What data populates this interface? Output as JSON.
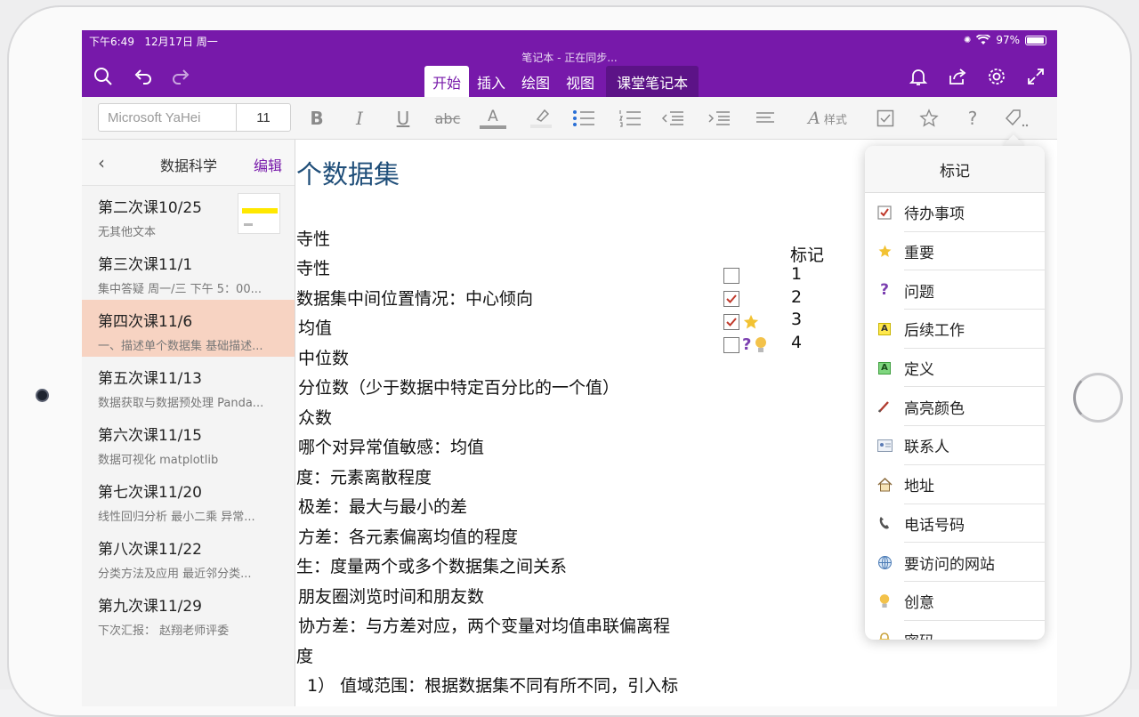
{
  "status": {
    "time": "下午6:49",
    "date": "12月17日 周一",
    "battery": "97%"
  },
  "window": {
    "sync_title": "笔记本 - 正在同步..."
  },
  "tabs": [
    {
      "label": "开始"
    },
    {
      "label": "插入"
    },
    {
      "label": "绘图"
    },
    {
      "label": "视图"
    },
    {
      "label": "课堂笔记本"
    }
  ],
  "ribbon": {
    "font_name": "Microsoft YaHei",
    "font_size": "11",
    "styles_label": "样式"
  },
  "sidebar": {
    "title": "数据科学",
    "edit": "编辑",
    "pages": [
      {
        "title": "第二次课10/25",
        "sub": "无其他文本"
      },
      {
        "title": "第三次课11/1",
        "sub": "集中答疑  周一/三 下午 5：00..."
      },
      {
        "title": "第四次课11/6",
        "sub": "一、描述单个数据集  基础描述..."
      },
      {
        "title": "第五次课11/13",
        "sub": "数据获取与数据预处理  Panda..."
      },
      {
        "title": "第六次课11/15",
        "sub": "数据可视化  matplotlib"
      },
      {
        "title": "第七次课11/20",
        "sub": "线性回归分析  最小二乘  异常..."
      },
      {
        "title": "第八次课11/22",
        "sub": "分类方法及应用  最近邻分类..."
      },
      {
        "title": "第九次课11/29",
        "sub": "下次汇报：  赵翔老师评委"
      }
    ]
  },
  "content": {
    "heading": "个数据集",
    "lines": [
      "寺性",
      "寺性",
      "数据集中间位置情况：中心倾向",
      "均值",
      "中位数",
      "分位数（少于数据中特定百分比的一个值）",
      "众数",
      "哪个对异常值敏感：均值",
      "度：元素离散程度",
      "极差：最大与最小的差",
      "方差：各元素偏离均值的程度",
      "生：度量两个或多个数据集之间关系",
      "朋友圈浏览时间和朋友数",
      "协方差：与方差对应，两个变量对均值串联偏离程",
      "度",
      "1）  值域范围：根据数据集不同有所不同，引入标"
    ],
    "tags_title": "标记",
    "tag_numbers": [
      "1",
      "2",
      "3",
      "4"
    ]
  },
  "tags_panel": {
    "title": "标记",
    "items": [
      {
        "label": "待办事项",
        "icon": "checkbox-icon"
      },
      {
        "label": "重要",
        "icon": "star-icon"
      },
      {
        "label": "问题",
        "icon": "question-icon"
      },
      {
        "label": "后续工作",
        "icon": "follow-up-icon"
      },
      {
        "label": "定义",
        "icon": "definition-icon"
      },
      {
        "label": "高亮颜色",
        "icon": "pen-icon"
      },
      {
        "label": "联系人",
        "icon": "contact-card-icon"
      },
      {
        "label": "地址",
        "icon": "house-icon"
      },
      {
        "label": "电话号码",
        "icon": "phone-icon"
      },
      {
        "label": "要访问的网站",
        "icon": "globe-icon"
      },
      {
        "label": "创意",
        "icon": "lightbulb-icon"
      },
      {
        "label": "密码",
        "icon": "lock-icon"
      }
    ]
  },
  "colors": {
    "accent": "#7719aa",
    "selected_page": "#f7d3c2",
    "heading": "#1f4e79"
  }
}
